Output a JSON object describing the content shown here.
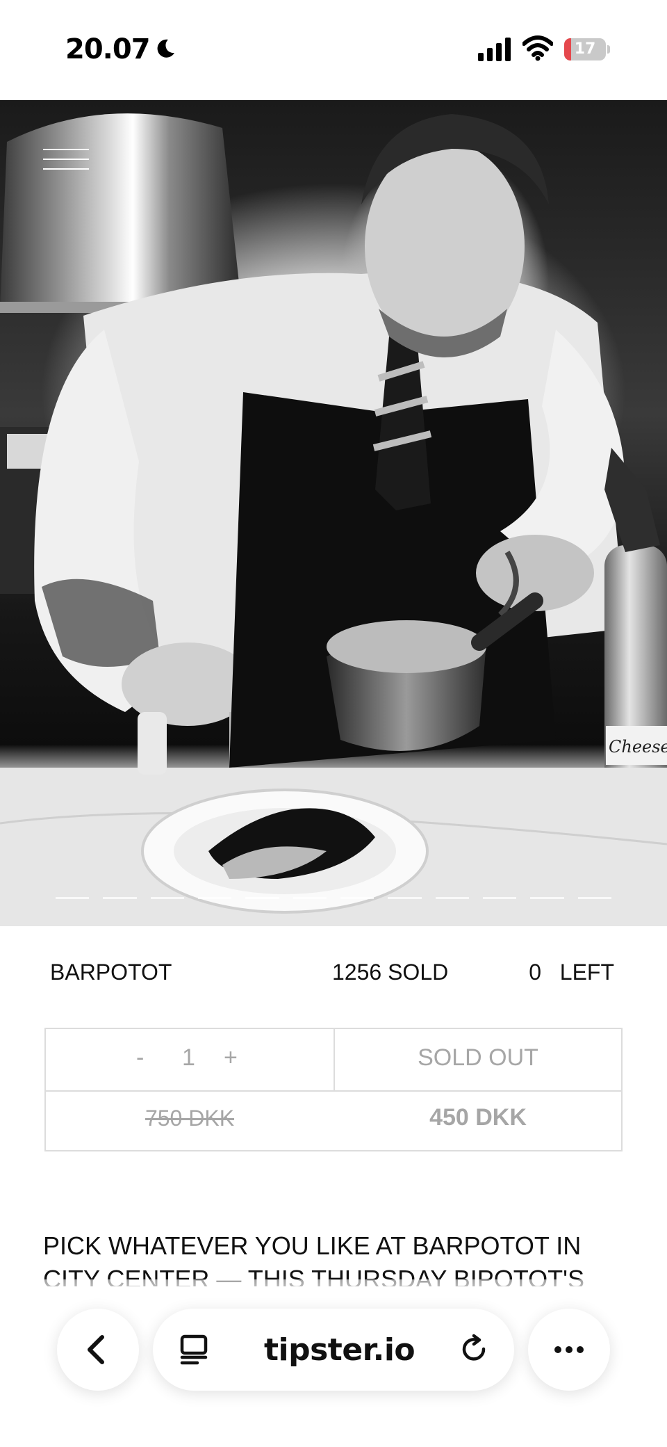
{
  "status_bar": {
    "time": "20.07",
    "battery_level": "17",
    "battery_fraction": 0.17
  },
  "hero": {
    "carousel_count": 12,
    "active_index": 4,
    "label_on_canister": "Cheese"
  },
  "product": {
    "venue": "BARPOTOT",
    "sold": "1256 SOLD",
    "left": "0   LEFT"
  },
  "purchase": {
    "minus": "-",
    "quantity": "1",
    "plus": "+",
    "status": "SOLD OUT",
    "original_price": "750 DKK",
    "price": "450 DKK"
  },
  "description": {
    "line1": "PICK WHATEVER YOU LIKE AT BARPOTOT IN",
    "line2": "CITY CENTER — THIS THURSDAY BIPOTOT'S"
  },
  "browser": {
    "url": "tipster.io",
    "icons": [
      "chevron-left-icon",
      "reader-icon",
      "reload-icon",
      "more-icon"
    ]
  }
}
